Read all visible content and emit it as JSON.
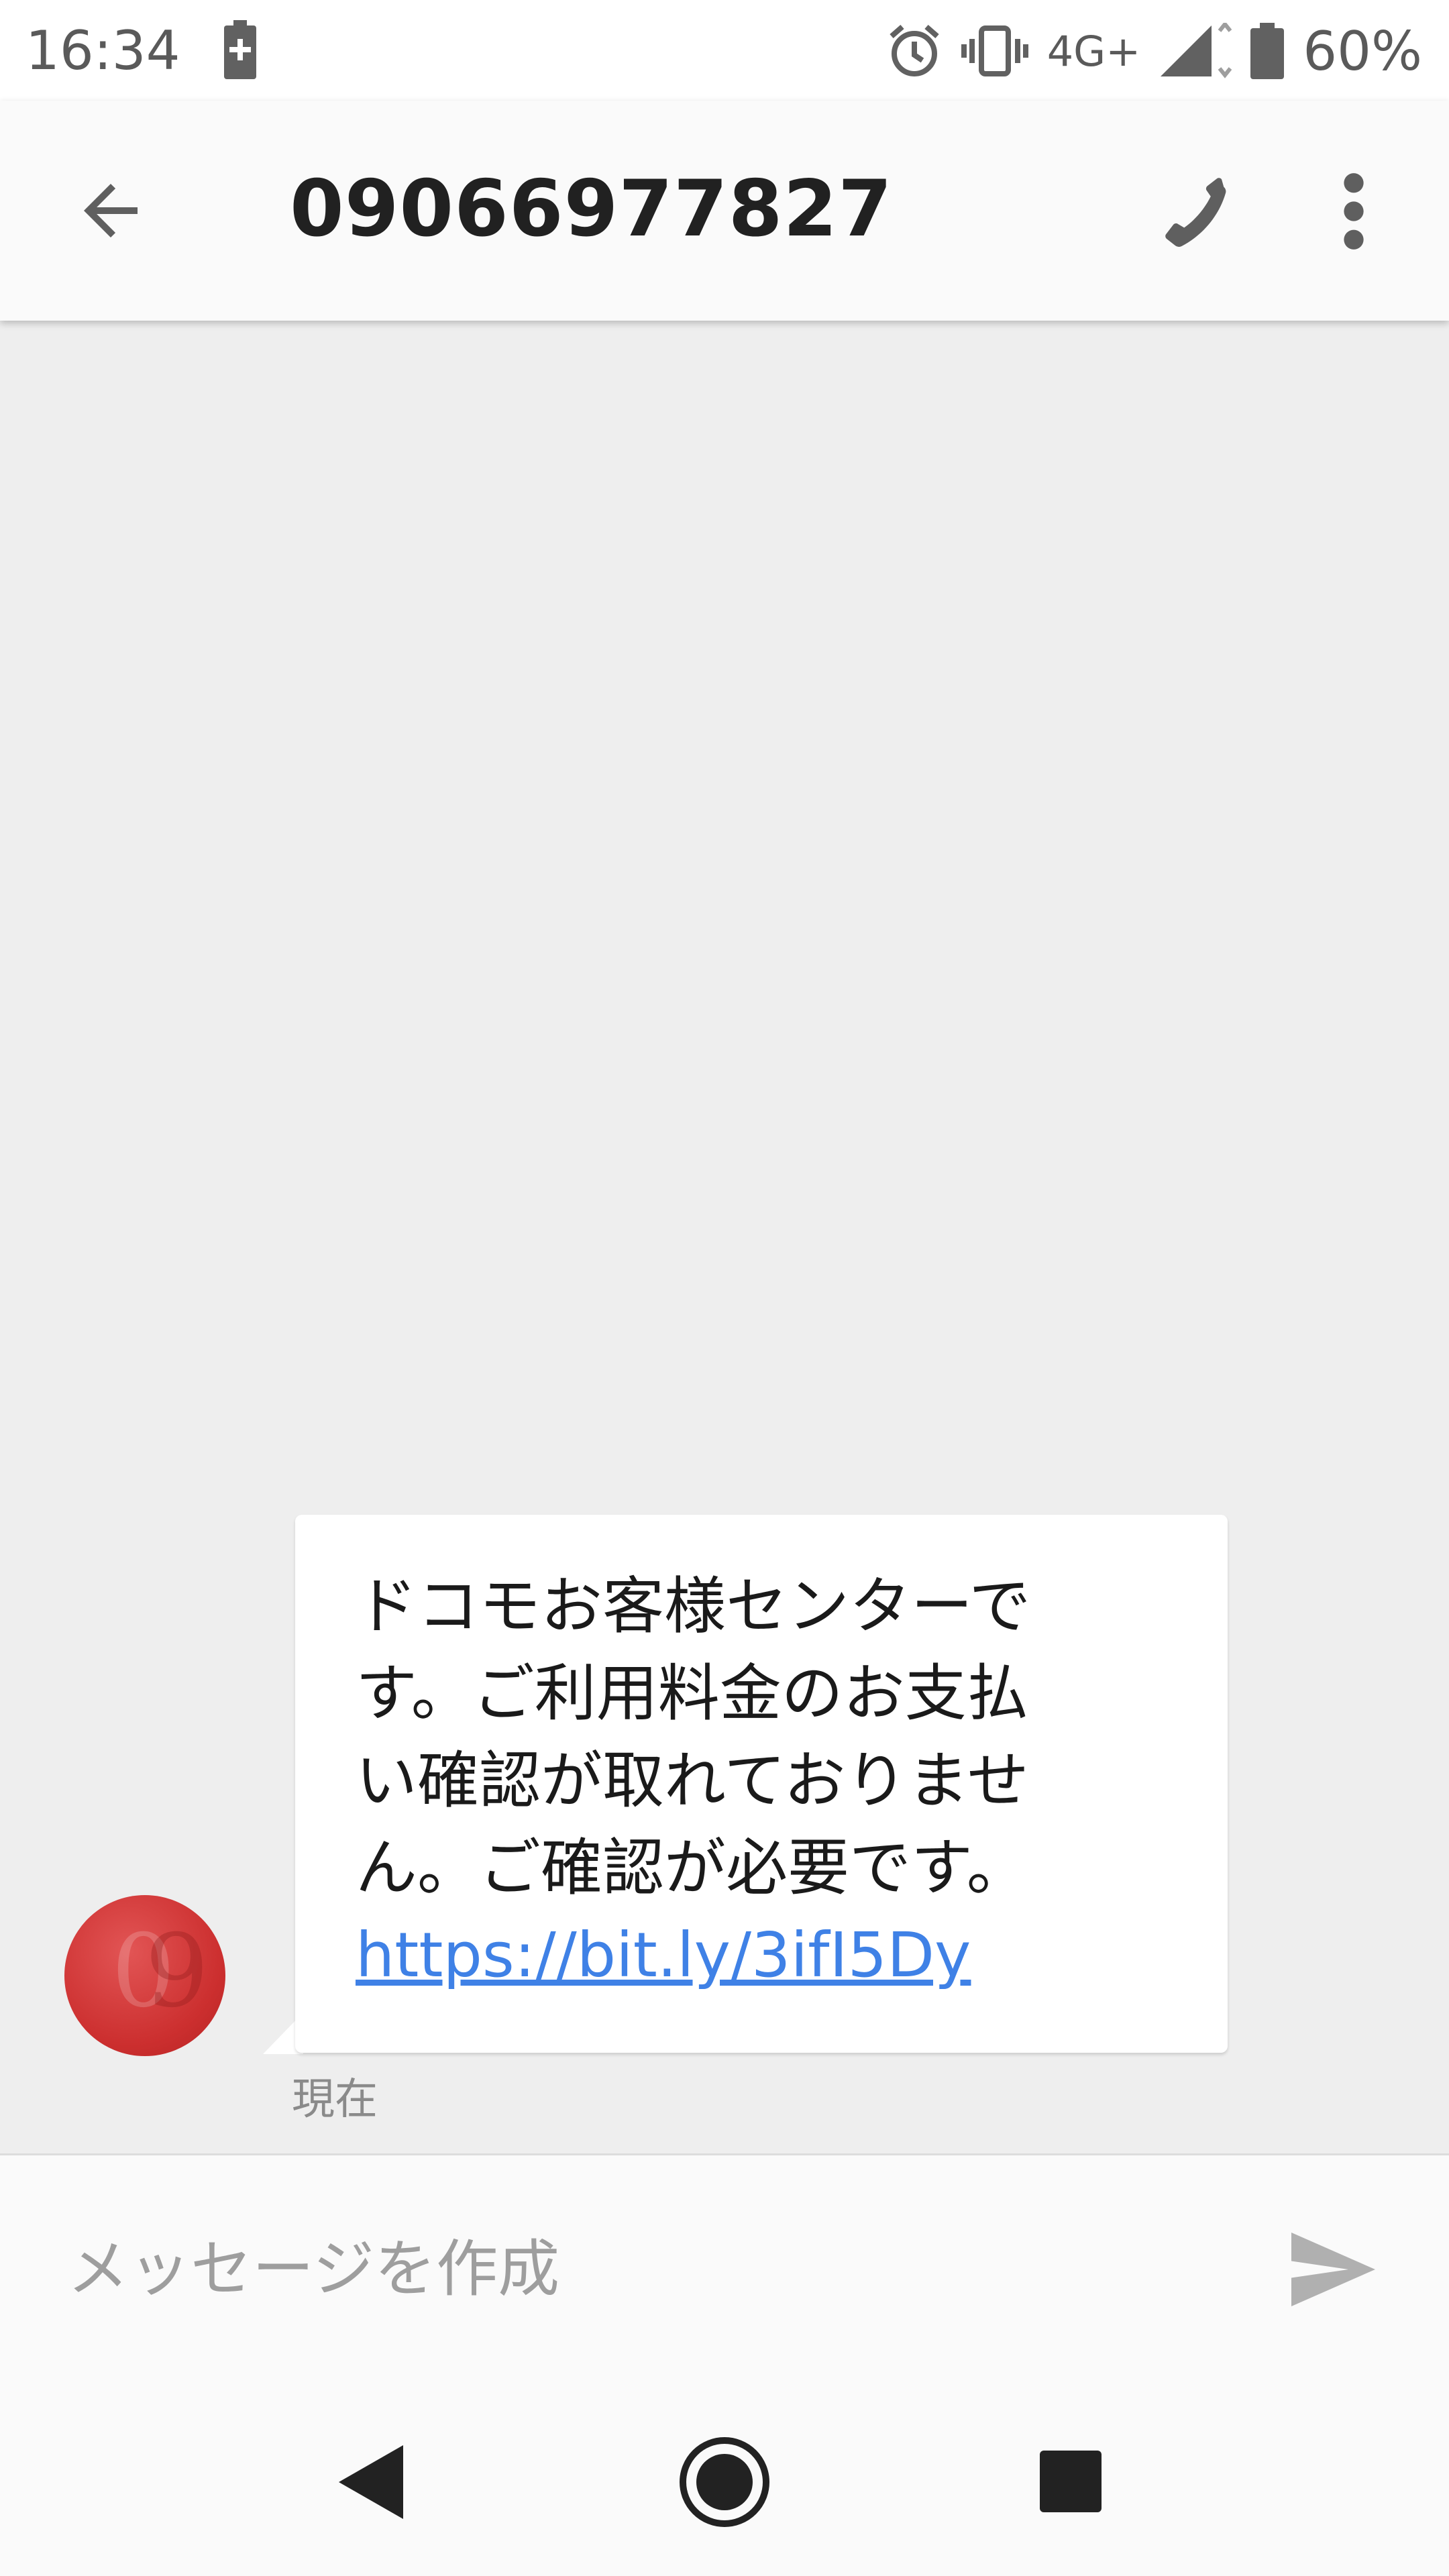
{
  "status_bar": {
    "time": "16:34",
    "network": "4G+",
    "battery_percent": "60%",
    "icons": [
      "battery-charging-icon",
      "alarm-icon",
      "vibrate-icon",
      "signal-icon",
      "battery-icon"
    ]
  },
  "app_bar": {
    "title": "09066977827",
    "icons": [
      "back-arrow-icon",
      "phone-call-icon",
      "more-vert-icon"
    ]
  },
  "conversation": {
    "avatar_color": "#d03131",
    "messages": [
      {
        "direction": "incoming",
        "lines": [
          "ドコモお客様センターで",
          "す。ご利用料金のお支払",
          "い確認が取れておりませ",
          "ん。ご確認が必要です。"
        ],
        "link": "https://bit.ly/3ifI5Dy",
        "timestamp": "現在"
      }
    ]
  },
  "composer": {
    "placeholder": "メッセージを作成",
    "send_icon": "send-icon"
  },
  "nav_bar": {
    "icons": [
      "nav-back-icon",
      "nav-home-icon",
      "nav-recents-icon"
    ]
  },
  "colors": {
    "link": "#3f81e6",
    "background": "#eeeeee",
    "bubble": "#ffffff",
    "icon_gray": "#616161"
  }
}
